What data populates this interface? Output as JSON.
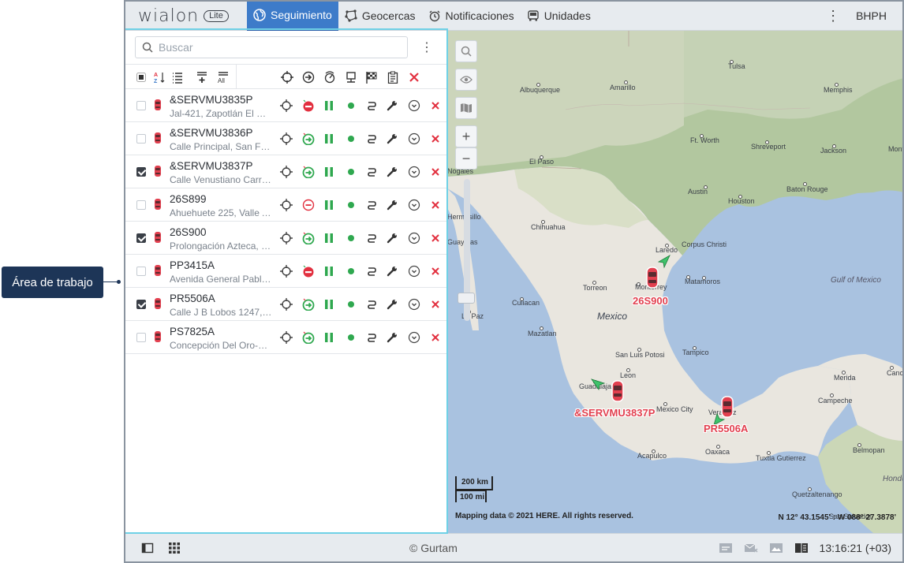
{
  "callout": {
    "label": "Área de trabajo"
  },
  "header": {
    "logo_word": "wialon",
    "logo_badge": "Lite",
    "tabs": [
      {
        "label": "Seguimiento",
        "icon": "globe-icon",
        "active": true
      },
      {
        "label": "Geocercas",
        "icon": "geofence-icon",
        "active": false
      },
      {
        "label": "Notificaciones",
        "icon": "alarm-clock-icon",
        "active": false
      },
      {
        "label": "Unidades",
        "icon": "bus-icon",
        "active": false
      }
    ],
    "user": "BHPH"
  },
  "search": {
    "placeholder": "Buscar",
    "value": ""
  },
  "toolbar": {
    "all_label": "All",
    "sort_label_top": "A",
    "sort_label_bottom": "Z"
  },
  "units": [
    {
      "name": "&SERVMU3835P",
      "address": "Jal-421, Zapotlán El Gr...",
      "checked": false,
      "motion": "stop",
      "motion_color": "#e2303f"
    },
    {
      "name": "&SERVMU3836P",
      "address": "Calle Principal, San Fra...",
      "checked": false,
      "motion": "go",
      "motion_color": "#2fa84f"
    },
    {
      "name": "&SERVMU3837P",
      "address": "Calle Venustiano Carra...",
      "checked": true,
      "motion": "go",
      "motion_color": "#2fa84f"
    },
    {
      "name": "26S899",
      "address": "Ahuehuete 225, Valle A...",
      "checked": false,
      "motion": "stop-outline",
      "motion_color": "#e2303f"
    },
    {
      "name": "26S900",
      "address": "Prolongación Azteca, L...",
      "checked": true,
      "motion": "go",
      "motion_color": "#2fa84f"
    },
    {
      "name": "PP3415A",
      "address": "Avenida General Pablo ...",
      "checked": false,
      "motion": "stop",
      "motion_color": "#e2303f"
    },
    {
      "name": "PR5506A",
      "address": "Calle J B Lobos 1247, ...",
      "checked": true,
      "motion": "go",
      "motion_color": "#2fa84f"
    },
    {
      "name": "PS7825A",
      "address": "Concepción Del Oro-Te...",
      "checked": false,
      "motion": "go",
      "motion_color": "#2fa84f"
    }
  ],
  "map": {
    "labels": [
      {
        "text": "Tulsa",
        "cls": ""
      },
      {
        "text": "Albuquerque",
        "cls": ""
      },
      {
        "text": "Amarillo",
        "cls": ""
      },
      {
        "text": "Memphis",
        "cls": ""
      },
      {
        "text": "Ft. Worth",
        "cls": ""
      },
      {
        "text": "Shreveport",
        "cls": ""
      },
      {
        "text": "Jackson",
        "cls": ""
      },
      {
        "text": "Montg",
        "cls": ""
      },
      {
        "text": "El Paso",
        "cls": ""
      },
      {
        "text": "Nogales",
        "cls": ""
      },
      {
        "text": "Austin",
        "cls": ""
      },
      {
        "text": "Baton Rouge",
        "cls": ""
      },
      {
        "text": "Houston",
        "cls": ""
      },
      {
        "text": "Hermosillo",
        "cls": ""
      },
      {
        "text": "Chihuahua",
        "cls": ""
      },
      {
        "text": "Guaymas",
        "cls": ""
      },
      {
        "text": "Corpus Christi",
        "cls": ""
      },
      {
        "text": "Laredo",
        "cls": ""
      },
      {
        "text": "Gulf of Mexico",
        "cls": "it"
      },
      {
        "text": "Torreon",
        "cls": ""
      },
      {
        "text": "Monterrey",
        "cls": ""
      },
      {
        "text": "Matamoros",
        "cls": ""
      },
      {
        "text": "Culiacan",
        "cls": ""
      },
      {
        "text": "Mexico",
        "cls": "big"
      },
      {
        "text": "La Paz",
        "cls": ""
      },
      {
        "text": "Mazatlan",
        "cls": ""
      },
      {
        "text": "San Luis Potosi",
        "cls": ""
      },
      {
        "text": "Tampico",
        "cls": ""
      },
      {
        "text": "Leon",
        "cls": ""
      },
      {
        "text": "Guadalajara",
        "cls": ""
      },
      {
        "text": "Mexico City",
        "cls": ""
      },
      {
        "text": "Veracruz",
        "cls": ""
      },
      {
        "text": "Merida",
        "cls": ""
      },
      {
        "text": "Cancu",
        "cls": ""
      },
      {
        "text": "Campeche",
        "cls": ""
      },
      {
        "text": "Acapulco",
        "cls": ""
      },
      {
        "text": "Oaxaca",
        "cls": ""
      },
      {
        "text": "Tuxtla Gutierrez",
        "cls": ""
      },
      {
        "text": "Belmopan",
        "cls": ""
      },
      {
        "text": "Hondu",
        "cls": "it"
      },
      {
        "text": "Quetzaltenango",
        "cls": ""
      },
      {
        "text": "San Salvador",
        "cls": ""
      }
    ],
    "unit_labels": [
      {
        "text": "26S900"
      },
      {
        "text": "&SERVMU3837P"
      },
      {
        "text": "PR5506A"
      }
    ],
    "scale_km": "200 km",
    "scale_mi": "100 mi",
    "copyright": "Mapping data © 2021 HERE. All rights reserved.",
    "coords": "N 12° 43.1545' : W 088° 27.3878'"
  },
  "footer": {
    "copyright": "© Gurtam",
    "time": "13:16:21 (+03)"
  }
}
